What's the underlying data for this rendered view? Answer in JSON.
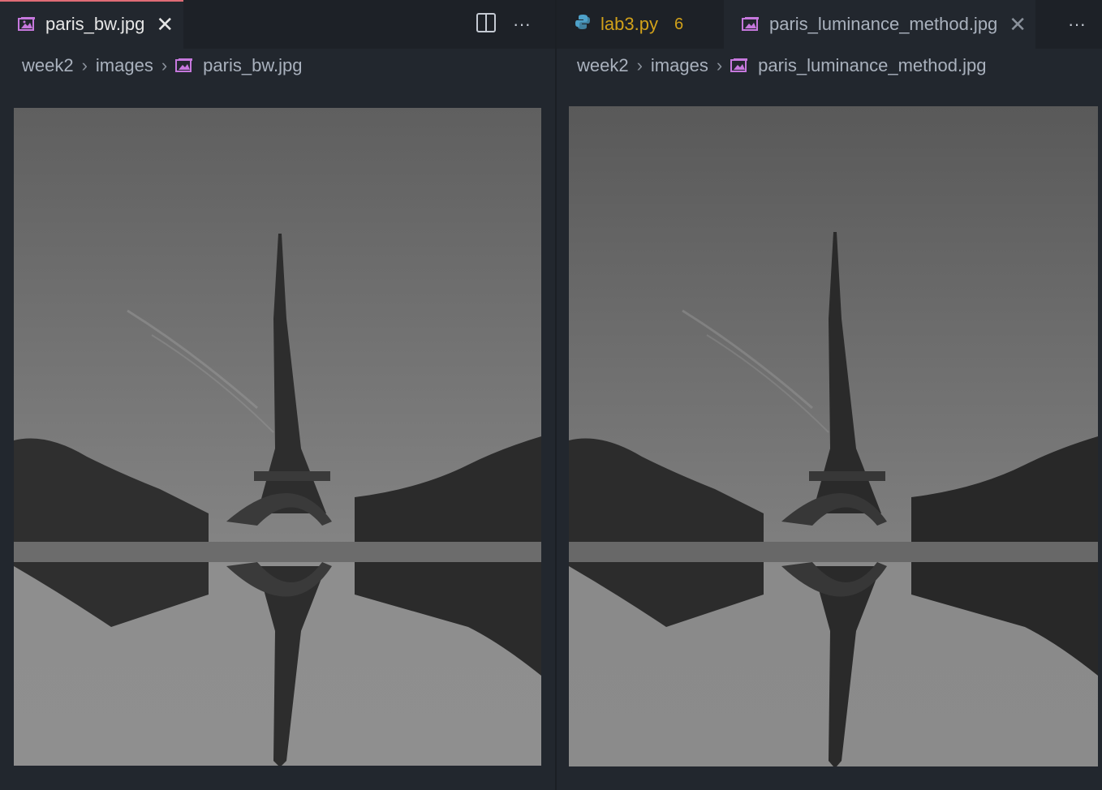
{
  "left_group": {
    "tabs": [
      {
        "label": "paris_bw.jpg",
        "icon": "image-icon",
        "close": "✕"
      }
    ],
    "actions": {
      "split": "split-editor-icon",
      "more": "···"
    },
    "breadcrumb": [
      "week2",
      "images",
      "paris_bw.jpg"
    ],
    "image": {
      "alt": "paris_bw.jpg",
      "color_mode": "grayscale"
    }
  },
  "right_group": {
    "tabs": [
      {
        "label": "lab3.py",
        "icon": "python-icon",
        "badge": "6"
      },
      {
        "label": "paris_luminance_method.jpg",
        "icon": "image-icon",
        "close": "✕"
      }
    ],
    "actions": {
      "more": "···"
    },
    "breadcrumb": [
      "week2",
      "images",
      "paris_luminance_method.jpg"
    ],
    "image": {
      "alt": "paris_luminance_method.jpg",
      "color_mode": "grayscale"
    }
  },
  "colors": {
    "accent_tab_line": "#e06c75",
    "modified_file": "#d1a11a",
    "image_icon": "#c678dd",
    "python_icon": "#4ea1c9"
  }
}
